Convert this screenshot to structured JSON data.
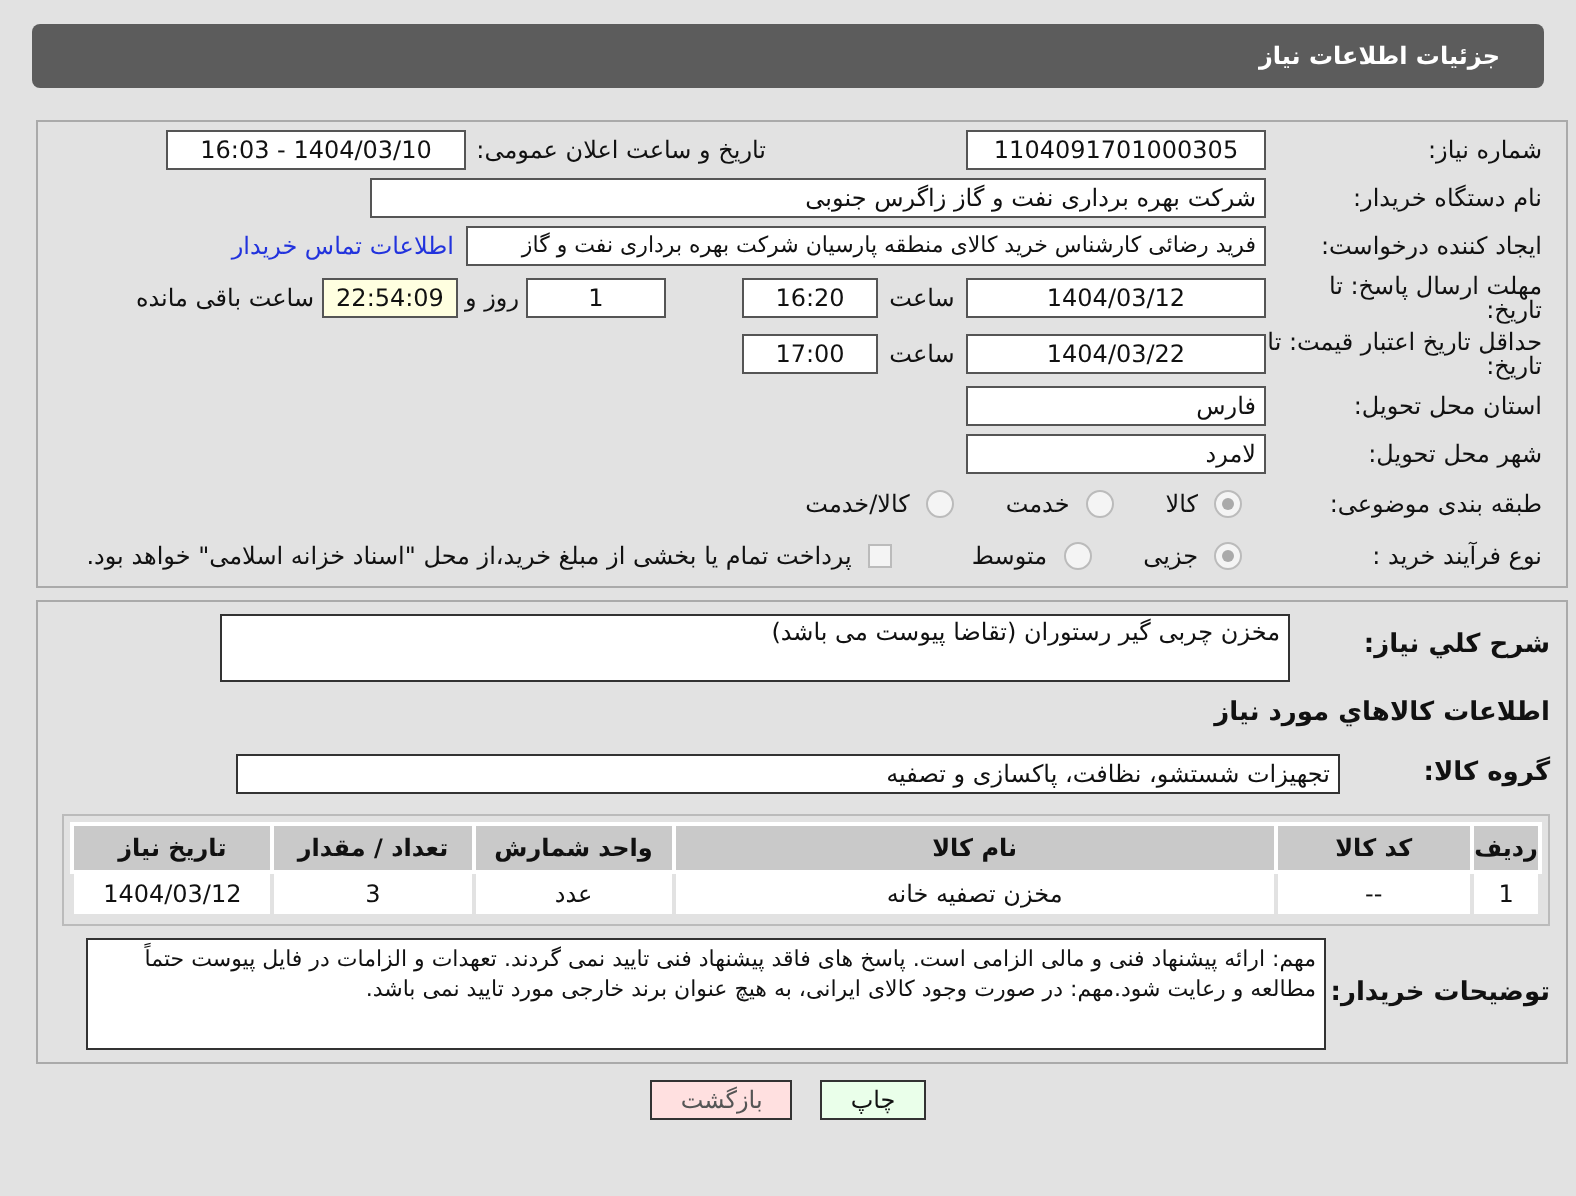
{
  "header": {
    "title": "جزئیات اطلاعات نیاز"
  },
  "info": {
    "tender_number": {
      "label": "شماره نیاز:",
      "value": "1104091701000305"
    },
    "announce": {
      "label": "تاریخ و ساعت اعلان عمومی:",
      "value": "1404/03/10 - 16:03"
    },
    "buyer_org": {
      "label": "نام دستگاه خریدار:",
      "value": "شرکت بهره برداری نفت و گاز زاگرس جنوبی"
    },
    "creator": {
      "label": "ایجاد کننده درخواست:",
      "value": "فرید رضائی کارشناس خرید کالای منطقه پارسیان شرکت بهره برداری نفت و گاز",
      "link": "اطلاعات تماس خریدار"
    },
    "response_deadline": {
      "label": "مهلت ارسال پاسخ: تا تاریخ:",
      "date": "1404/03/12",
      "time_label": "ساعت",
      "time": "16:20",
      "days": "1",
      "days_label": "روز و",
      "remaining": "22:54:09",
      "remaining_label": "ساعت باقی مانده"
    },
    "price_validity": {
      "label": "حداقل تاریخ اعتبار قیمت: تا تاریخ:",
      "date": "1404/03/22",
      "time_label": "ساعت",
      "time": "17:00"
    },
    "province": {
      "label": "استان محل تحویل:",
      "value": "فارس"
    },
    "city": {
      "label": "شهر محل تحویل:",
      "value": "لامرد"
    },
    "category": {
      "label": "طبقه بندی موضوعی:",
      "options": [
        {
          "label": "کالا",
          "selected": true
        },
        {
          "label": "خدمت",
          "selected": false
        },
        {
          "label": "کالا/خدمت",
          "selected": false
        }
      ]
    },
    "process": {
      "label": "نوع فرآیند خرید :",
      "options": [
        {
          "label": "جزیی",
          "selected": true
        },
        {
          "label": "متوسط",
          "selected": false
        }
      ],
      "payment_checkbox": {
        "label": "پرداخت تمام یا بخشی از مبلغ خرید،از محل \"اسناد خزانه اسلامی\" خواهد بود.",
        "checked": false
      }
    }
  },
  "description": {
    "label": "شرح كلي نياز:",
    "value": "مخزن چربی گیر رستوران (تقاضا پیوست می باشد)"
  },
  "goods_heading": "اطلاعات كالاهاي مورد نياز",
  "goods_group": {
    "label": "گروه كالا:",
    "value": "تجهیزات شستشو، نظافت، پاکسازی و تصفیه"
  },
  "table": {
    "columns": [
      "ردیف",
      "کد کالا",
      "نام کالا",
      "واحد شمارش",
      "تعداد / مقدار",
      "تاریخ نیاز"
    ],
    "rows": [
      [
        "1",
        "--",
        "مخزن تصفیه خانه",
        "عدد",
        "3",
        "1404/03/12"
      ]
    ]
  },
  "buyer_notes": {
    "label": "توضیحات خریدار:",
    "value": "مهم: ارائه پیشنهاد فنی و مالی الزامی است. پاسخ های فاقد پیشنهاد فنی تایید نمی گردند. تعهدات و الزامات در فایل پیوست حتماً مطالعه و رعایت شود.مهم:  در صورت وجود کالای ایرانی، به هیچ عنوان برند خارجی مورد تایید نمی باشد."
  },
  "buttons": [
    {
      "label": "چاپ",
      "kind": "print"
    },
    {
      "label": "بازگشت",
      "kind": "back"
    }
  ]
}
